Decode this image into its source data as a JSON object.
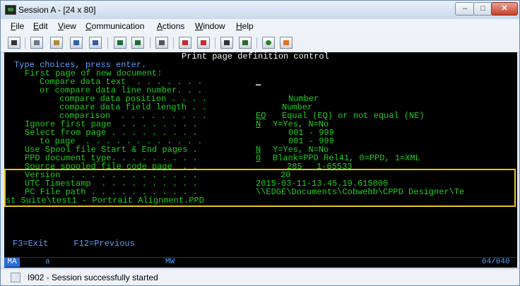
{
  "window": {
    "title": "Session A - [24 x 80]",
    "min_glyph": "–",
    "max_glyph": "□",
    "close_glyph": "✕"
  },
  "menu": [
    {
      "key": "F",
      "rest": "ile"
    },
    {
      "key": "E",
      "rest": "dit"
    },
    {
      "key": "V",
      "rest": "iew"
    },
    {
      "key": "C",
      "rest": "ommunication"
    },
    {
      "key": "A",
      "rest": "ctions"
    },
    {
      "key": "W",
      "rest": "indow"
    },
    {
      "key": "H",
      "rest": "elp"
    }
  ],
  "toolbar": {
    "icons": [
      "print-screen-icon",
      "copy-icon",
      "paste-icon",
      "send-icon",
      "receive-icon",
      "display-icon",
      "keyboard-icon",
      "macro-record-icon",
      "macro-stop-icon",
      "macro-play-icon",
      "macro-step-icon",
      "globe-icon",
      "tag-icon"
    ]
  },
  "screen": {
    "title": "Print page definition control",
    "instruction": "Type choices, press enter.",
    "first_page_header": "First page of new document:",
    "compare_text_label": "Compare data text  . . . . . . .",
    "compare_text_value": "_",
    "compare_line_label": "or compare data line number. . .",
    "compare_pos_label": "compare data position . . . .",
    "compare_pos_hint": "Number",
    "compare_len_label": "compare data field length . .",
    "compare_len_hint": "Number",
    "comparison_label": "comparison  . . . . . . . . .",
    "comparison_value": "EQ",
    "comparison_hint": "Equal (EQ) or not equal (NE)",
    "ignore_label": "Ignore first page  . . . . . . . .",
    "ignore_value": "N",
    "ignore_hint": "Y=Yes, N=No",
    "select_label": "Select from page . . . . . . . . .",
    "select_hint": "001 - 999",
    "to_page_label": "to page  . . . . . . . . . . . .",
    "to_page_hint": "001 - 999",
    "spool_label": "Use Spool file Start & End pages .",
    "spool_value": "N",
    "spool_hint": "Y=Yes, N=No",
    "ppd_type_label": "PPD document type. . . . . . . . .",
    "ppd_type_value": "0",
    "ppd_type_hint": "Blank=PPD Rel41, 0=PPD, 1=XML",
    "codepage_label": "Source spooled file code page  . .",
    "codepage_value": "285",
    "codepage_hint": "1-65533",
    "version_label": "Version  . . . . . . . . . . . . .",
    "version_value": "20",
    "utc_label": "UTC Timestamp  . . . . . . . . . .",
    "utc_value": "2015-03-11-13.45.19.615000",
    "path_label": "PC File path . . . . . . . . . . .",
    "path_value_1": "\\\\EDGE\\Documents\\Cobwebb\\CPPD Designer\\Te",
    "path_value_2": "st Suite\\test1 - Portrait Alignment.PPD",
    "fkeys": "F3=Exit     F12=Previous"
  },
  "oia": {
    "indicator": "MA",
    "session": "a",
    "mode": "MW",
    "cursor": "04/040"
  },
  "status": {
    "message": "I902 - Session successfully started"
  },
  "colors": {
    "field_green": "#22cc22",
    "title_white": "#f5f5f5",
    "instruction_blue": "#5aa0ff",
    "highlight_box": "#e8c31d"
  }
}
